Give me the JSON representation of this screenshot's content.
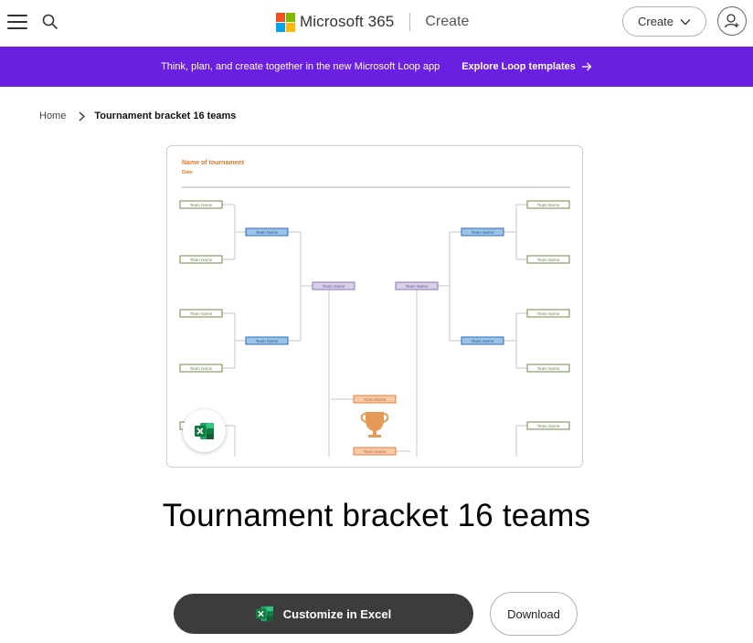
{
  "header": {
    "brand_name": "Microsoft 365",
    "brand_sub": "Create",
    "create_label": "Create",
    "ms_colors": [
      "#f25022",
      "#7fba00",
      "#00a4ef",
      "#ffb900"
    ]
  },
  "banner": {
    "text": "Think, plan, and create together in the new Microsoft Loop app",
    "link_label": "Explore Loop templates",
    "color": "#6b1fe1"
  },
  "breadcrumb": {
    "home": "Home",
    "current": "Tournament bracket 16 teams"
  },
  "preview": {
    "tournament_name": "Name of tournament",
    "date_label": "Date",
    "slot_label": "Team Name",
    "round1_color": "#c9d9b5",
    "round2_color": "#9cc3ea",
    "round3_color": "#d9cfe8",
    "final_color": "#f6c9a8",
    "trophy_color": "#e59a57"
  },
  "title": "Tournament bracket 16 teams",
  "actions": {
    "customize_label": "Customize in Excel",
    "download_label": "Download"
  }
}
